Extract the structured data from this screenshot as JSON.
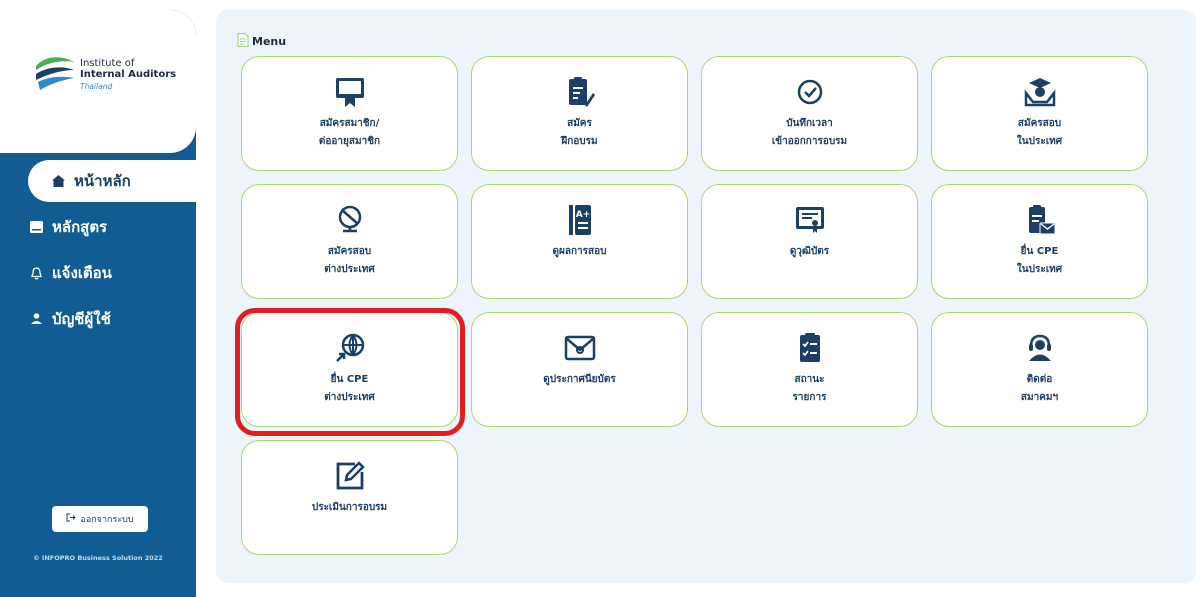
{
  "sidebar": {
    "logo": {
      "line1": "Institute of",
      "line2": "Internal Auditors",
      "line3": "Thailand"
    },
    "nav": [
      {
        "label": "หน้าหลัก",
        "icon": "home-icon",
        "active": true
      },
      {
        "label": "หลักสูตร",
        "icon": "book-icon",
        "active": false
      },
      {
        "label": "แจ้งเตือน",
        "icon": "bell-icon",
        "active": false
      },
      {
        "label": "บัญชีผู้ใช้",
        "icon": "user-icon",
        "active": false
      }
    ],
    "logout_label": "ออกจากระบบ",
    "copyright": "© INFOPRO Business Solution 2022"
  },
  "main": {
    "menu_title": "Menu",
    "tiles": [
      {
        "label": "สมัครสมาชิก/\nต่ออายุสมาชิก",
        "icon": "membership-card-icon"
      },
      {
        "label": "สมัคร\nฝึกอบรม",
        "icon": "clipboard-pen-icon"
      },
      {
        "label": "บันทึกเวลา\nเข้าออกการอบรม",
        "icon": "check-circle-icon"
      },
      {
        "label": "สมัครสอบ\nในประเทศ",
        "icon": "graduate-hands-icon"
      },
      {
        "label": "สมัครสอบ\nต่างประเทศ",
        "icon": "globe-icon"
      },
      {
        "label": "ดูผลการสอบ",
        "icon": "grade-report-icon"
      },
      {
        "label": "ดูวุฒิบัตร",
        "icon": "certificate-icon"
      },
      {
        "label": "ยื่น CPE\nในประเทศ",
        "icon": "clipboard-mail-icon"
      },
      {
        "label": "ยื่น CPE\nต่างประเทศ",
        "icon": "globe-send-icon"
      },
      {
        "label": "ดูประกาศนียบัตร",
        "icon": "envelope-icon"
      },
      {
        "label": "สถานะ\nรายการ",
        "icon": "checklist-icon"
      },
      {
        "label": "ติดต่อ\nสมาคมฯ",
        "icon": "headset-icon"
      },
      {
        "label": "ประเมินการอบรม",
        "icon": "edit-icon"
      }
    ]
  },
  "colors": {
    "sidebar": "#125c94",
    "panel": "#ecf5fb",
    "tile_border": "#a8d873",
    "highlight": "#e01e1e",
    "text": "#1b3f66"
  }
}
